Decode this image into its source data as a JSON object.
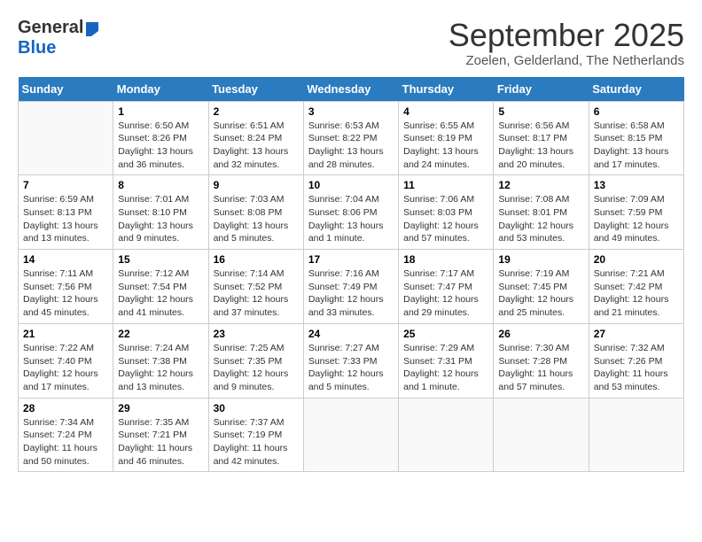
{
  "logo": {
    "text_general": "General",
    "text_blue": "Blue"
  },
  "title": {
    "month_year": "September 2025",
    "location": "Zoelen, Gelderland, The Netherlands"
  },
  "days_of_week": [
    "Sunday",
    "Monday",
    "Tuesday",
    "Wednesday",
    "Thursday",
    "Friday",
    "Saturday"
  ],
  "weeks": [
    [
      {
        "day": "",
        "sunrise": "",
        "sunset": "",
        "daylight": ""
      },
      {
        "day": "1",
        "sunrise": "Sunrise: 6:50 AM",
        "sunset": "Sunset: 8:26 PM",
        "daylight": "Daylight: 13 hours and 36 minutes."
      },
      {
        "day": "2",
        "sunrise": "Sunrise: 6:51 AM",
        "sunset": "Sunset: 8:24 PM",
        "daylight": "Daylight: 13 hours and 32 minutes."
      },
      {
        "day": "3",
        "sunrise": "Sunrise: 6:53 AM",
        "sunset": "Sunset: 8:22 PM",
        "daylight": "Daylight: 13 hours and 28 minutes."
      },
      {
        "day": "4",
        "sunrise": "Sunrise: 6:55 AM",
        "sunset": "Sunset: 8:19 PM",
        "daylight": "Daylight: 13 hours and 24 minutes."
      },
      {
        "day": "5",
        "sunrise": "Sunrise: 6:56 AM",
        "sunset": "Sunset: 8:17 PM",
        "daylight": "Daylight: 13 hours and 20 minutes."
      },
      {
        "day": "6",
        "sunrise": "Sunrise: 6:58 AM",
        "sunset": "Sunset: 8:15 PM",
        "daylight": "Daylight: 13 hours and 17 minutes."
      }
    ],
    [
      {
        "day": "7",
        "sunrise": "Sunrise: 6:59 AM",
        "sunset": "Sunset: 8:13 PM",
        "daylight": "Daylight: 13 hours and 13 minutes."
      },
      {
        "day": "8",
        "sunrise": "Sunrise: 7:01 AM",
        "sunset": "Sunset: 8:10 PM",
        "daylight": "Daylight: 13 hours and 9 minutes."
      },
      {
        "day": "9",
        "sunrise": "Sunrise: 7:03 AM",
        "sunset": "Sunset: 8:08 PM",
        "daylight": "Daylight: 13 hours and 5 minutes."
      },
      {
        "day": "10",
        "sunrise": "Sunrise: 7:04 AM",
        "sunset": "Sunset: 8:06 PM",
        "daylight": "Daylight: 13 hours and 1 minute."
      },
      {
        "day": "11",
        "sunrise": "Sunrise: 7:06 AM",
        "sunset": "Sunset: 8:03 PM",
        "daylight": "Daylight: 12 hours and 57 minutes."
      },
      {
        "day": "12",
        "sunrise": "Sunrise: 7:08 AM",
        "sunset": "Sunset: 8:01 PM",
        "daylight": "Daylight: 12 hours and 53 minutes."
      },
      {
        "day": "13",
        "sunrise": "Sunrise: 7:09 AM",
        "sunset": "Sunset: 7:59 PM",
        "daylight": "Daylight: 12 hours and 49 minutes."
      }
    ],
    [
      {
        "day": "14",
        "sunrise": "Sunrise: 7:11 AM",
        "sunset": "Sunset: 7:56 PM",
        "daylight": "Daylight: 12 hours and 45 minutes."
      },
      {
        "day": "15",
        "sunrise": "Sunrise: 7:12 AM",
        "sunset": "Sunset: 7:54 PM",
        "daylight": "Daylight: 12 hours and 41 minutes."
      },
      {
        "day": "16",
        "sunrise": "Sunrise: 7:14 AM",
        "sunset": "Sunset: 7:52 PM",
        "daylight": "Daylight: 12 hours and 37 minutes."
      },
      {
        "day": "17",
        "sunrise": "Sunrise: 7:16 AM",
        "sunset": "Sunset: 7:49 PM",
        "daylight": "Daylight: 12 hours and 33 minutes."
      },
      {
        "day": "18",
        "sunrise": "Sunrise: 7:17 AM",
        "sunset": "Sunset: 7:47 PM",
        "daylight": "Daylight: 12 hours and 29 minutes."
      },
      {
        "day": "19",
        "sunrise": "Sunrise: 7:19 AM",
        "sunset": "Sunset: 7:45 PM",
        "daylight": "Daylight: 12 hours and 25 minutes."
      },
      {
        "day": "20",
        "sunrise": "Sunrise: 7:21 AM",
        "sunset": "Sunset: 7:42 PM",
        "daylight": "Daylight: 12 hours and 21 minutes."
      }
    ],
    [
      {
        "day": "21",
        "sunrise": "Sunrise: 7:22 AM",
        "sunset": "Sunset: 7:40 PM",
        "daylight": "Daylight: 12 hours and 17 minutes."
      },
      {
        "day": "22",
        "sunrise": "Sunrise: 7:24 AM",
        "sunset": "Sunset: 7:38 PM",
        "daylight": "Daylight: 12 hours and 13 minutes."
      },
      {
        "day": "23",
        "sunrise": "Sunrise: 7:25 AM",
        "sunset": "Sunset: 7:35 PM",
        "daylight": "Daylight: 12 hours and 9 minutes."
      },
      {
        "day": "24",
        "sunrise": "Sunrise: 7:27 AM",
        "sunset": "Sunset: 7:33 PM",
        "daylight": "Daylight: 12 hours and 5 minutes."
      },
      {
        "day": "25",
        "sunrise": "Sunrise: 7:29 AM",
        "sunset": "Sunset: 7:31 PM",
        "daylight": "Daylight: 12 hours and 1 minute."
      },
      {
        "day": "26",
        "sunrise": "Sunrise: 7:30 AM",
        "sunset": "Sunset: 7:28 PM",
        "daylight": "Daylight: 11 hours and 57 minutes."
      },
      {
        "day": "27",
        "sunrise": "Sunrise: 7:32 AM",
        "sunset": "Sunset: 7:26 PM",
        "daylight": "Daylight: 11 hours and 53 minutes."
      }
    ],
    [
      {
        "day": "28",
        "sunrise": "Sunrise: 7:34 AM",
        "sunset": "Sunset: 7:24 PM",
        "daylight": "Daylight: 11 hours and 50 minutes."
      },
      {
        "day": "29",
        "sunrise": "Sunrise: 7:35 AM",
        "sunset": "Sunset: 7:21 PM",
        "daylight": "Daylight: 11 hours and 46 minutes."
      },
      {
        "day": "30",
        "sunrise": "Sunrise: 7:37 AM",
        "sunset": "Sunset: 7:19 PM",
        "daylight": "Daylight: 11 hours and 42 minutes."
      },
      {
        "day": "",
        "sunrise": "",
        "sunset": "",
        "daylight": ""
      },
      {
        "day": "",
        "sunrise": "",
        "sunset": "",
        "daylight": ""
      },
      {
        "day": "",
        "sunrise": "",
        "sunset": "",
        "daylight": ""
      },
      {
        "day": "",
        "sunrise": "",
        "sunset": "",
        "daylight": ""
      }
    ]
  ]
}
